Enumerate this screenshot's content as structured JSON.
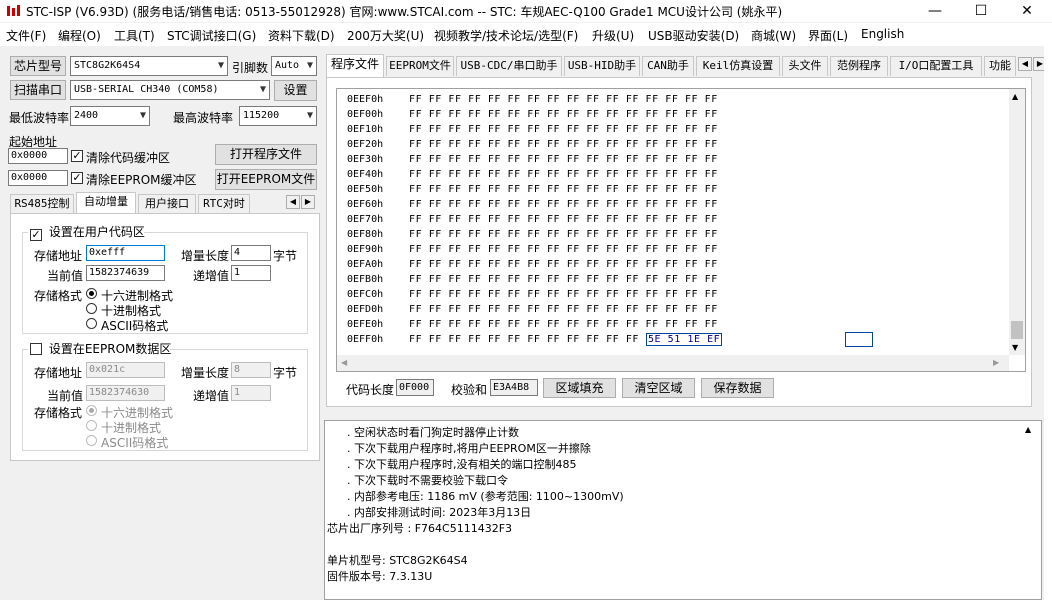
{
  "titlebar": {
    "title": "STC-ISP (V6.93D) (服务电话/销售电话: 0513-55012928) 官网:www.STCAI.com  -- STC: 车规AEC-Q100 Grade1 MCU设计公司 (姚永平)",
    "minimize": "—",
    "maximize": "☐",
    "close": "✕"
  },
  "menu": [
    "文件(F)",
    "编程(O)",
    "工具(T)",
    "STC调试接口(G)",
    "资料下载(D)",
    "200万大奖(U)",
    "视频教学/技术论坛/选型(F)",
    "升级(U)",
    "USB驱动安装(D)",
    "商城(W)",
    "界面(L)",
    "English"
  ],
  "left": {
    "chip_btn": "芯片型号",
    "chip_value": "STC8G2K64S4",
    "pins_label": "引脚数",
    "pins_value": "Auto",
    "scan_btn": "扫描串口",
    "port_value": "USB-SERIAL CH340 (COM58)",
    "settings_btn": "设置",
    "min_baud_label": "最低波特率",
    "min_baud_value": "2400",
    "max_baud_label": "最高波特率",
    "max_baud_value": "115200",
    "start_addr_label": "起始地址",
    "code_addr": "0x0000",
    "clear_code_label": "清除代码缓冲区",
    "open_prog_btn": "打开程序文件",
    "eeprom_addr": "0x0000",
    "clear_eeprom_label": "清除EEPROM缓冲区",
    "open_eeprom_btn": "打开EEPROM文件",
    "tabs": [
      "RS485控制",
      "自动增量",
      "用户接口",
      "RTC对时"
    ],
    "user_code": {
      "title": "设置在用户代码区",
      "store_addr_label": "存储地址",
      "store_addr_value": "0xefff",
      "inc_len_label": "增量长度",
      "inc_len_value": "4",
      "bytes_unit": "字节",
      "cur_val_label": "当前值",
      "cur_val_value": "1582374639",
      "step_label": "递增值",
      "step_value": "1",
      "format_label": "存储格式",
      "formats": [
        "十六进制格式",
        "十进制格式",
        "ASCII码格式"
      ]
    },
    "eeprom": {
      "title": "设置在EEPROM数据区",
      "store_addr_label": "存储地址",
      "store_addr_value": "0x021c",
      "inc_len_label": "增量长度",
      "inc_len_value": "8",
      "bytes_unit": "字节",
      "cur_val_label": "当前值",
      "cur_val_value": "1582374630",
      "step_label": "递增值",
      "step_value": "1",
      "format_label": "存储格式",
      "formats": [
        "十六进制格式",
        "十进制格式",
        "ASCII码格式"
      ]
    }
  },
  "right_tabs": [
    "程序文件",
    "EEPROM文件",
    "USB-CDC/串口助手",
    "USB-HID助手",
    "CAN助手",
    "Keil仿真设置",
    "头文件",
    "范例程序",
    "I/O口配置工具",
    "功能"
  ],
  "hex": {
    "rows": [
      {
        "addr": "0EEF0h",
        "bytes": "FF FF FF FF FF FF FF FF FF FF FF FF FF FF FF FF"
      },
      {
        "addr": "0EF00h",
        "bytes": "FF FF FF FF FF FF FF FF FF FF FF FF FF FF FF FF"
      },
      {
        "addr": "0EF10h",
        "bytes": "FF FF FF FF FF FF FF FF FF FF FF FF FF FF FF FF"
      },
      {
        "addr": "0EF20h",
        "bytes": "FF FF FF FF FF FF FF FF FF FF FF FF FF FF FF FF"
      },
      {
        "addr": "0EF30h",
        "bytes": "FF FF FF FF FF FF FF FF FF FF FF FF FF FF FF FF"
      },
      {
        "addr": "0EF40h",
        "bytes": "FF FF FF FF FF FF FF FF FF FF FF FF FF FF FF FF"
      },
      {
        "addr": "0EF50h",
        "bytes": "FF FF FF FF FF FF FF FF FF FF FF FF FF FF FF FF"
      },
      {
        "addr": "0EF60h",
        "bytes": "FF FF FF FF FF FF FF FF FF FF FF FF FF FF FF FF"
      },
      {
        "addr": "0EF70h",
        "bytes": "FF FF FF FF FF FF FF FF FF FF FF FF FF FF FF FF"
      },
      {
        "addr": "0EF80h",
        "bytes": "FF FF FF FF FF FF FF FF FF FF FF FF FF FF FF FF"
      },
      {
        "addr": "0EF90h",
        "bytes": "FF FF FF FF FF FF FF FF FF FF FF FF FF FF FF FF"
      },
      {
        "addr": "0EFA0h",
        "bytes": "FF FF FF FF FF FF FF FF FF FF FF FF FF FF FF FF"
      },
      {
        "addr": "0EFB0h",
        "bytes": "FF FF FF FF FF FF FF FF FF FF FF FF FF FF FF FF"
      },
      {
        "addr": "0EFC0h",
        "bytes": "FF FF FF FF FF FF FF FF FF FF FF FF FF FF FF FF"
      },
      {
        "addr": "0EFD0h",
        "bytes": "FF FF FF FF FF FF FF FF FF FF FF FF FF FF FF FF"
      },
      {
        "addr": "0EFE0h",
        "bytes": "FF FF FF FF FF FF FF FF FF FF FF FF FF FF FF FF"
      },
      {
        "addr": "0EFF0h",
        "bytes": "FF FF FF FF FF FF FF FF FF FF FF FF",
        "highlight": "5E 51 1E EF"
      }
    ]
  },
  "bottom_bar": {
    "code_len_label": "代码长度",
    "code_len_value": "0F000",
    "checksum_label": "校验和",
    "checksum_value": "E3A4B8",
    "fill_btn": "区域填充",
    "clear_btn": "清空区域",
    "save_btn": "保存数据"
  },
  "log_lines": [
    ". 空闲状态时看门狗定时器停止计数",
    ". 下次下载用户程序时,将用户EEPROM区一并擦除",
    ". 下次下载用户程序时,没有相关的端口控制485",
    ". 下次下载时不需要校验下载口令",
    ". 内部参考电压: 1186 mV (参考范围: 1100~1300mV)",
    ". 内部安排测试时间: 2023年3月13日",
    "芯片出厂序列号 : F764C5111432F3",
    "",
    "  单片机型号: STC8G2K64S4",
    "  固件版本号: 7.3.13U"
  ]
}
